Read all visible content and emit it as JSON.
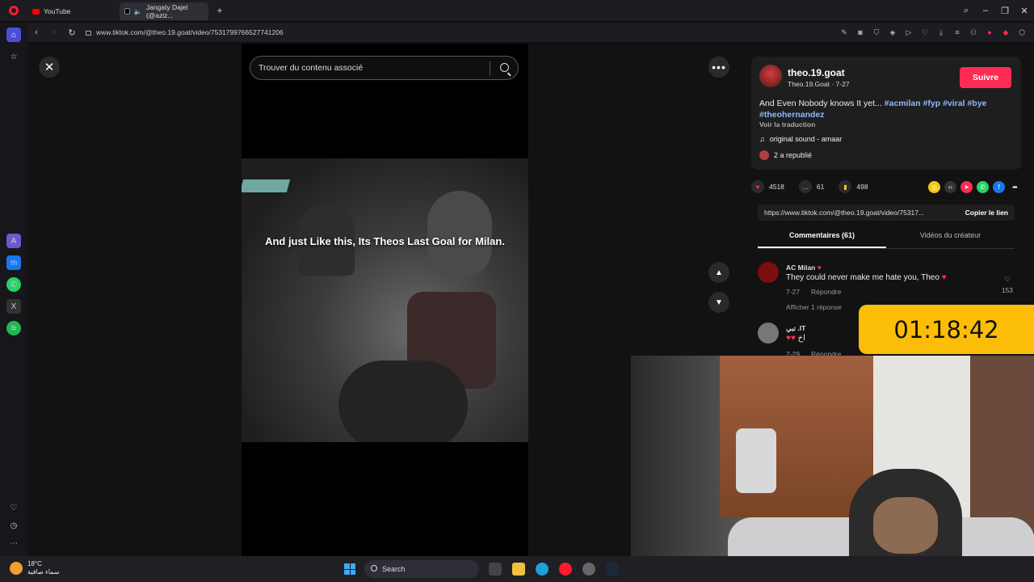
{
  "browser": {
    "tabs": [
      {
        "label": "YouTube"
      },
      {
        "label": "Jangaty Dajel (@aziz..."
      }
    ],
    "url": "www.tiktok.com/@theo.19.goat/video/7531799766527741206"
  },
  "tiktok": {
    "search_placeholder": "Trouver du contenu associé",
    "video_caption": "And just Like this, Its Theos Last Goal for Milan.",
    "author": {
      "username": "theo.19.goat",
      "subline": "Theo.19.Goat · 7-27",
      "follow_label": "Suivre"
    },
    "description": {
      "text": "And Even Nobody knows It yet...",
      "hashtags": [
        "#acmilan",
        "#fyp",
        "#viral",
        "#bye",
        "#theohernandez"
      ],
      "translate_label": "Voir la traduction",
      "sound": "original sound - amaar",
      "reposted": "2 a republié"
    },
    "stats": {
      "likes": "4518",
      "comments": "61",
      "saves": "498"
    },
    "share_link": "https://www.tiktok.com/@theo.19.goat/video/75317...",
    "copy_link_label": "Copier le lien",
    "tabs": {
      "comments": "Commentaires (61)",
      "creator_videos": "Vidéos du créateur"
    },
    "comments": [
      {
        "author": "AC Milan",
        "text": "They could never make me hate you, Theo",
        "date": "7-27",
        "reply_label": "Répondre",
        "likes": "153",
        "more_replies": "Afficher 1 réponse"
      },
      {
        "author": "تبي .IT",
        "text": "اخ",
        "date": "7-29",
        "reply_label": "Répondre"
      }
    ]
  },
  "overlay": {
    "timer": "01:18:42"
  },
  "taskbar": {
    "temperature": "18°C",
    "weather": "سماء صافية",
    "search_label": "Search"
  },
  "colors": {
    "accent_pink": "#fe2c55",
    "opera_red": "#ff1b2d",
    "timer_bg": "#fbbd08",
    "hashtag": "#8fb8ff"
  }
}
